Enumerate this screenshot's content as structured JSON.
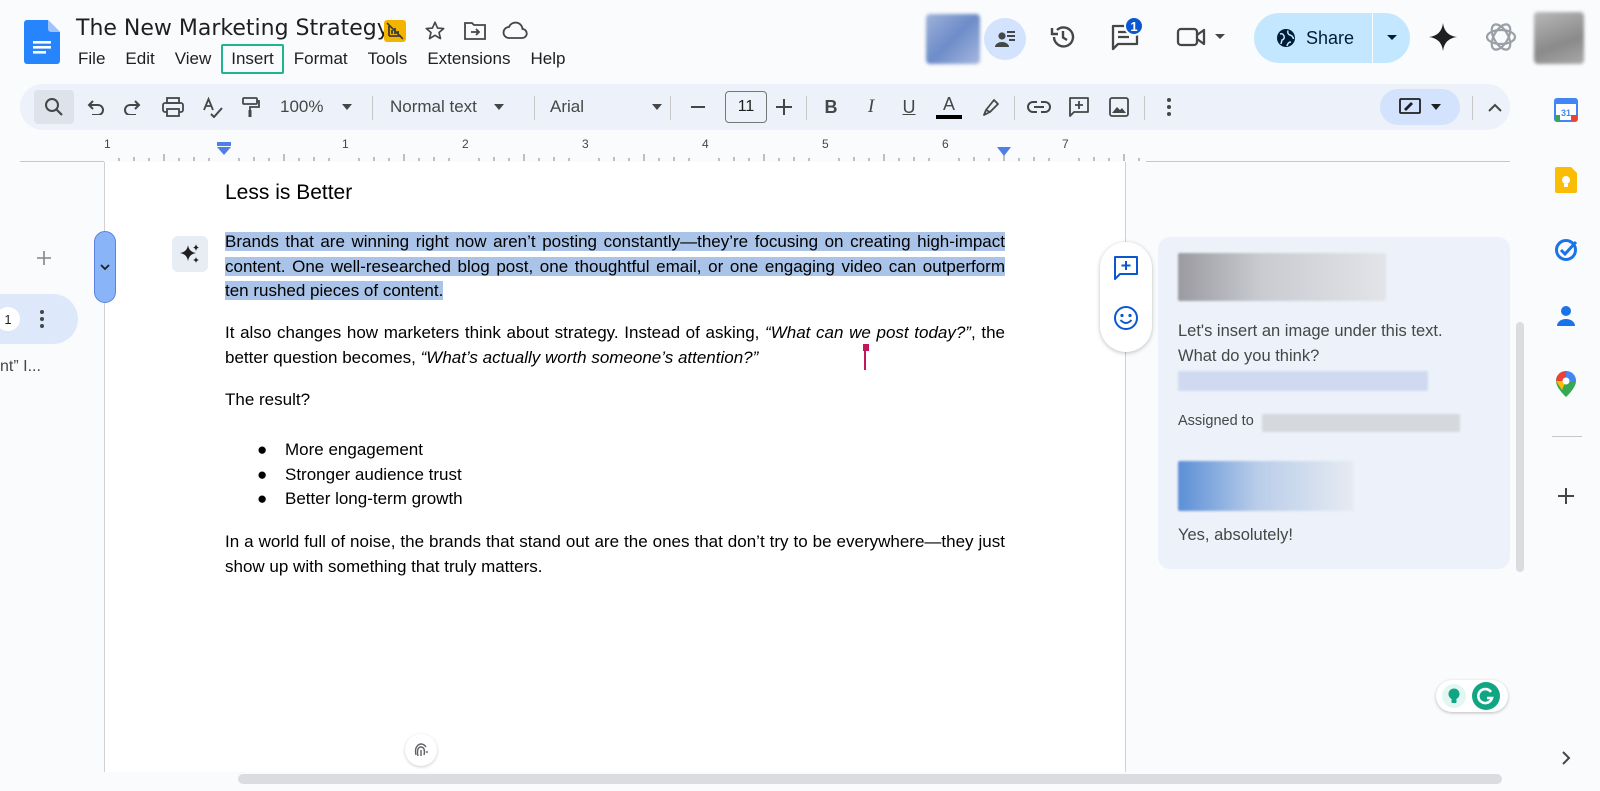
{
  "document": {
    "title": "The New Marketing Strategy"
  },
  "menu": [
    "File",
    "Edit",
    "View",
    "Insert",
    "Format",
    "Tools",
    "Extensions",
    "Help"
  ],
  "header": {
    "comments_badge": "1",
    "share_label": "Share"
  },
  "toolbar": {
    "zoom": "100%",
    "style": "Normal text",
    "font": "Arial",
    "font_size": "11"
  },
  "ruler": {
    "labels": [
      "1",
      "1",
      "2",
      "3",
      "4",
      "5",
      "6",
      "7"
    ]
  },
  "outline": {
    "page_number": "1",
    "snippet": "nt” I..."
  },
  "content": {
    "heading": "Less is Better",
    "para1": "Brands that are winning right now aren’t posting constantly—they’re focusing on creating high-impact content. One well-researched blog post, one thoughtful email, or one engaging video can outperform ten rushed pieces of content.",
    "para2_a": "It also changes how marketers think about strategy. Instead of asking, ",
    "para2_q1": "“What can we post today?”",
    "para2_b": ", the better question becomes, ",
    "para2_q2": "“What’s actually worth someone’s attention?”",
    "para3": "The result?",
    "bullets": [
      "More engagement",
      "Stronger audience trust",
      "Better long-term growth"
    ],
    "para4": "In a world full of noise, the brands that stand out are the ones that don’t try to be everywhere—they just show up with something that truly matters."
  },
  "comment": {
    "text": "Let's insert an image under this text. What do you think?",
    "assigned_label": "Assigned to",
    "reply": "Yes, absolutely!"
  },
  "colors": {
    "accent": "#0b57d0",
    "selection": "#a9c4e8",
    "share_bg": "#c2e7ff",
    "menu_highlight": "#1fb58f"
  }
}
